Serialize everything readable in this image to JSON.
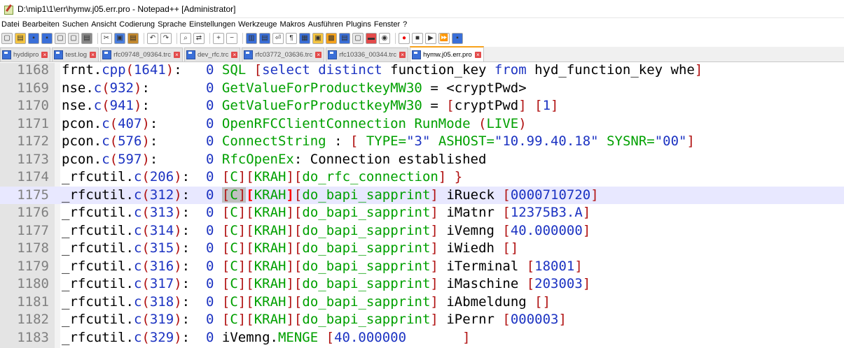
{
  "window": {
    "title": "D:\\mip1\\1\\err\\hymw.j05.err.pro - Notepad++ [Administrator]"
  },
  "menu": [
    "Datei",
    "Bearbeiten",
    "Suchen",
    "Ansicht",
    "Codierung",
    "Sprache",
    "Einstellungen",
    "Werkzeuge",
    "Makros",
    "Ausführen",
    "Plugins",
    "Fenster",
    "?"
  ],
  "tabs": [
    {
      "label": "hyddipro",
      "active": false
    },
    {
      "label": "test.log",
      "active": false
    },
    {
      "label": "rfc09748_09364.trc",
      "active": false
    },
    {
      "label": "dev_rfc.trc",
      "active": false
    },
    {
      "label": "rfc03772_03636.trc",
      "active": false
    },
    {
      "label": "rfc10336_00344.trc",
      "active": false
    },
    {
      "label": "hymw.j05.err.pro",
      "active": true
    }
  ],
  "colors": {
    "accent": "#f7a21b",
    "keyword": "#1c33c2",
    "green": "#00a000",
    "bracket": "#b01010",
    "highlight": "#e8e8ff"
  },
  "lines": [
    {
      "n": "1168",
      "src": "frnt.cpp(1641):",
      "zero": "0",
      "msg": "SQL [select distinct function_key from hyd_function_key whe"
    },
    {
      "n": "1169",
      "src": "nse.c(932):",
      "zero": "0",
      "msg": "GetValueForProductkeyMW30 = <cryptPwd>"
    },
    {
      "n": "1170",
      "src": "nse.c(941):",
      "zero": "0",
      "msg": "GetValueForProductkeyMW30 = [cryptPwd] [1]"
    },
    {
      "n": "1171",
      "src": "pcon.c(407):",
      "zero": "0",
      "msg": "OpenRFCClientConnection RunMode (LIVE)"
    },
    {
      "n": "1172",
      "src": "pcon.c(576):",
      "zero": "0",
      "msg": "ConnectString : [ TYPE=\"3\" ASHOST=\"10.99.40.18\" SYSNR=\"00\""
    },
    {
      "n": "1173",
      "src": "pcon.c(597):",
      "zero": "0",
      "msg": "RfcOpenEx: Connection established"
    },
    {
      "n": "1174",
      "src": "_rfcutil.c(206):",
      "zero": "0",
      "msg": "[C][KRAH][do_rfc_connection] }"
    },
    {
      "n": "1175",
      "src": "_rfcutil.c(312):",
      "zero": "0",
      "msg": "[C][KRAH][do_bapi_sapprint] iRueck [0000710720]"
    },
    {
      "n": "1176",
      "src": "_rfcutil.c(313):",
      "zero": "0",
      "msg": "[C][KRAH][do_bapi_sapprint] iMatnr [12375B3.A]"
    },
    {
      "n": "1177",
      "src": "_rfcutil.c(314):",
      "zero": "0",
      "msg": "[C][KRAH][do_bapi_sapprint] iVemng [40.000000]"
    },
    {
      "n": "1178",
      "src": "_rfcutil.c(315):",
      "zero": "0",
      "msg": "[C][KRAH][do_bapi_sapprint] iWiedh []"
    },
    {
      "n": "1179",
      "src": "_rfcutil.c(316):",
      "zero": "0",
      "msg": "[C][KRAH][do_bapi_sapprint] iTerminal [18001]"
    },
    {
      "n": "1180",
      "src": "_rfcutil.c(317):",
      "zero": "0",
      "msg": "[C][KRAH][do_bapi_sapprint] iMaschine [203003]"
    },
    {
      "n": "1181",
      "src": "_rfcutil.c(318):",
      "zero": "0",
      "msg": "[C][KRAH][do_bapi_sapprint] iAbmeldung []"
    },
    {
      "n": "1182",
      "src": "_rfcutil.c(319):",
      "zero": "0",
      "msg": "[C][KRAH][do_bapi_sapprint] iPernr [000003]"
    },
    {
      "n": "1183",
      "src": "_rfcutil.c(329):",
      "zero": "0",
      "msg": "iVemng.MENGE [40.000000       ]"
    }
  ],
  "current_line": "1175"
}
